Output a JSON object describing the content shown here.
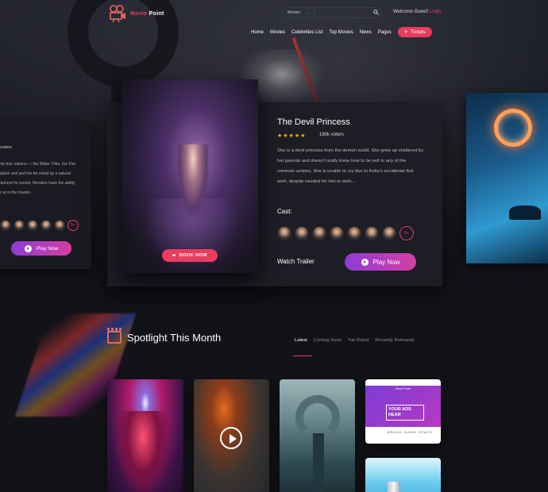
{
  "header": {
    "logo_text_1": "Movie",
    "logo_text_2": "Point",
    "search_category": "Movies",
    "search_placeholder": "",
    "welcome_text": "Welcome Guest!",
    "login_label": "Login",
    "nav": [
      "Home",
      "Movies",
      "Celebrities List",
      "Top Movies",
      "News",
      "Pages"
    ],
    "tickets_label": "Tickets"
  },
  "hero": {
    "left_card": {
      "voters": "voters",
      "synopsis": "into four nations — the Water Tribe, the Fire Nation and and the Air ented by a natural element for tamed. Benders have the ability to ar is the master...",
      "more_badge": "5+",
      "play_label": "Play Now"
    },
    "movie": {
      "title": "The Devil Princess",
      "stars": "★★★★★",
      "votes": "180k voters",
      "synopsis": "She is a devil princess from the demon world. She grew up sheltered by her parents and doesn't really know how to be evil or any of the common actions,  She is unable to cry due to Keita's accidental first wish, despite needed for him to wish...",
      "cast_label": "Cast:",
      "cast_more": "5+",
      "book_now": "BOOK NOW",
      "watch_trailer": "Watch Trailer",
      "play_now": "Play Now"
    }
  },
  "spotlight": {
    "title": "Spotlight This Month",
    "tabs": [
      "Latest",
      "Coming Soon",
      "Top Rated",
      "Recently Released"
    ],
    "ad": {
      "logo": "Movie Point",
      "headline": "YOUR ADS HEAR",
      "brand": "BRAND NAME SPACE"
    }
  },
  "colors": {
    "accent": "#e83d5f",
    "gradient_start": "#8e3cd6",
    "gradient_end": "#d43f9f",
    "star": "#f7b500"
  }
}
